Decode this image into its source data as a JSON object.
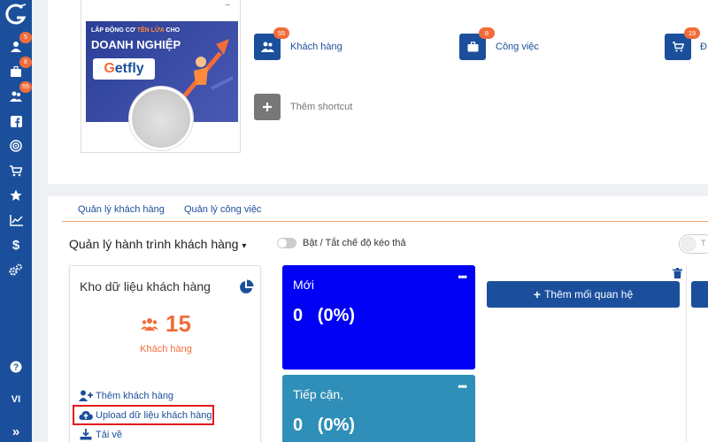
{
  "sidebar": {
    "badges": [
      "5",
      "8",
      "55"
    ],
    "lang": "VI",
    "bottom_arrow": "»",
    "icons": [
      "user-icon",
      "briefcase-icon",
      "users-icon",
      "facebook-icon",
      "target-icon",
      "cart-icon",
      "star-icon",
      "chart-line-icon",
      "dollar-icon",
      "cogs-icon",
      "help-icon"
    ]
  },
  "profile": {
    "menu": "...",
    "banner_small_1": "LẮP ĐỘNG CƠ ",
    "banner_small_hl": "TÊN LỬA",
    "banner_small_2": " CHO",
    "banner_big": "DOANH NGHIỆP",
    "banner_logo_g": "G",
    "banner_logo_rest": "etfly"
  },
  "shortcuts": [
    {
      "label": "Khách hàng",
      "badge": "55",
      "icon": "users-icon"
    },
    {
      "label": "Công việc",
      "badge": "8",
      "icon": "briefcase-icon"
    },
    {
      "label": "Đ",
      "badge": "19",
      "icon": "cart-icon"
    },
    {
      "label": "Thêm shortcut",
      "icon": "plus-icon"
    }
  ],
  "tabs": [
    "Quản lý khách hàng",
    "Quản lý công việc"
  ],
  "journey": {
    "title": "Quản lý hành trình khách hàng",
    "caret": "▾",
    "toggle_label": "Bật / Tắt chế độ kéo thả",
    "toggle_right_text": "T"
  },
  "data_card": {
    "title": "Kho dữ liệu khách hàng",
    "count": "15",
    "count_label": "Khách hàng",
    "links": [
      "Thêm khách hàng",
      "Upload dữ liệu khách hàng",
      "Tải về"
    ]
  },
  "stages": [
    {
      "name": "Mới",
      "value": "0   (0%)",
      "color": "#0000f5"
    },
    {
      "name": "Tiếp cận,",
      "value": "0   (0%)",
      "color": "#2f8fb8"
    }
  ],
  "stage_menu": "•••",
  "relations": {
    "add_button": "Thêm mối quan hệ",
    "plus": "+"
  },
  "colors": {
    "brand": "#1b4f9c",
    "accent": "#f26c3a",
    "highlight": "#e21b1b"
  }
}
